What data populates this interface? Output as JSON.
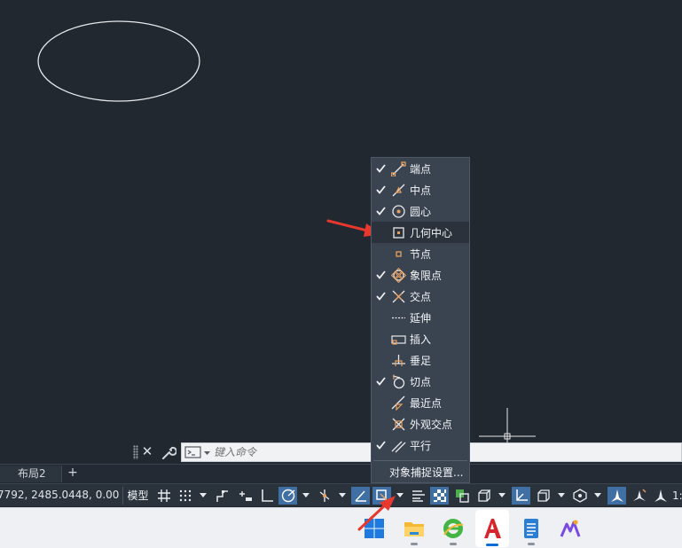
{
  "command_line": {
    "close_glyph": "✕",
    "placeholder": "键入命令"
  },
  "layout_tabs": {
    "active": "布局2",
    "add_glyph": "+"
  },
  "status_bar": {
    "coordinates": "7792, 2485.0448, 0.0000",
    "model_label": "模型",
    "truncated_right": "1:"
  },
  "snap_menu": {
    "items": [
      {
        "label": "端点",
        "checked": true,
        "icon": "endpoint-icon"
      },
      {
        "label": "中点",
        "checked": true,
        "icon": "midpoint-icon"
      },
      {
        "label": "圆心",
        "checked": true,
        "icon": "center-icon"
      },
      {
        "label": "几何中心",
        "checked": false,
        "icon": "geometric-center-icon",
        "highlighted": true
      },
      {
        "label": "节点",
        "checked": false,
        "icon": "node-icon"
      },
      {
        "label": "象限点",
        "checked": true,
        "icon": "quadrant-icon"
      },
      {
        "label": "交点",
        "checked": true,
        "icon": "intersection-icon"
      },
      {
        "label": "延伸",
        "checked": false,
        "icon": "extension-icon"
      },
      {
        "label": "插入",
        "checked": false,
        "icon": "insertion-icon"
      },
      {
        "label": "垂足",
        "checked": false,
        "icon": "perpendicular-icon"
      },
      {
        "label": "切点",
        "checked": true,
        "icon": "tangent-icon"
      },
      {
        "label": "最近点",
        "checked": false,
        "icon": "nearest-icon"
      },
      {
        "label": "外观交点",
        "checked": false,
        "icon": "apparent-intersection-icon"
      },
      {
        "label": "平行",
        "checked": true,
        "icon": "parallel-icon"
      }
    ],
    "settings_label": "对象捕捉设置..."
  },
  "colors": {
    "canvas": "#212830",
    "menu_bg": "#3a4350",
    "menu_hover": "#2b323c",
    "accent_orange": "#e8a060",
    "status_active": "#3f6fa3",
    "arrow_red": "#e8382e"
  }
}
